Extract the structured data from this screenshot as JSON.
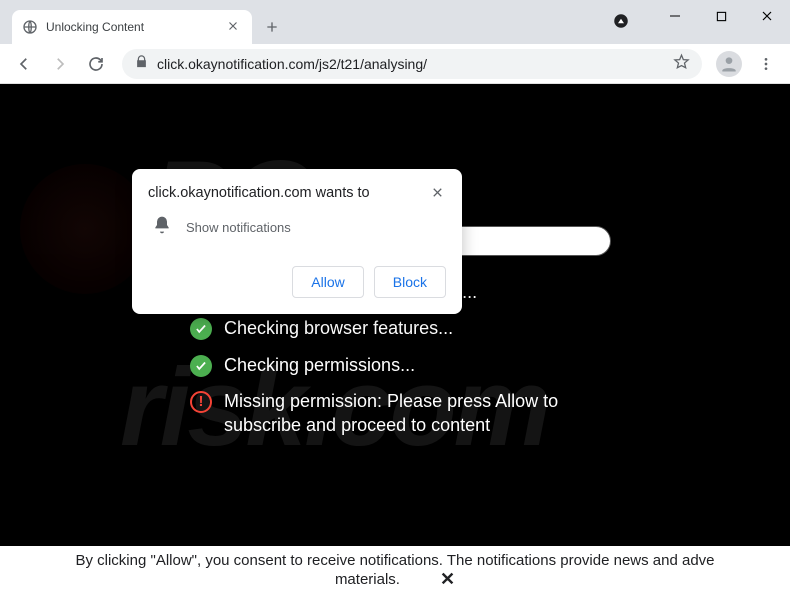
{
  "window": {
    "tab_title": "Unlocking Content",
    "url": "click.okaynotification.com/js2/t21/analysing/"
  },
  "notification_popup": {
    "origin_wants_to": "click.okaynotification.com wants to",
    "permission_label": "Show notifications",
    "allow_label": "Allow",
    "block_label": "Block"
  },
  "page": {
    "checks": [
      {
        "status": "ok",
        "text": "Checking browser information..."
      },
      {
        "status": "ok",
        "text": "Checking browser features..."
      },
      {
        "status": "ok",
        "text": "Checking permissions..."
      },
      {
        "status": "error",
        "text": "Missing permission: Please press Allow to subscribe and proceed to content"
      }
    ],
    "watermark_line1": "PC",
    "watermark_line2": "risk.com"
  },
  "footer": {
    "line1": "By clicking \"Allow\", you consent to receive notifications. The notifications provide news and adve",
    "line2": "materials.",
    "close_glyph": "✕"
  }
}
